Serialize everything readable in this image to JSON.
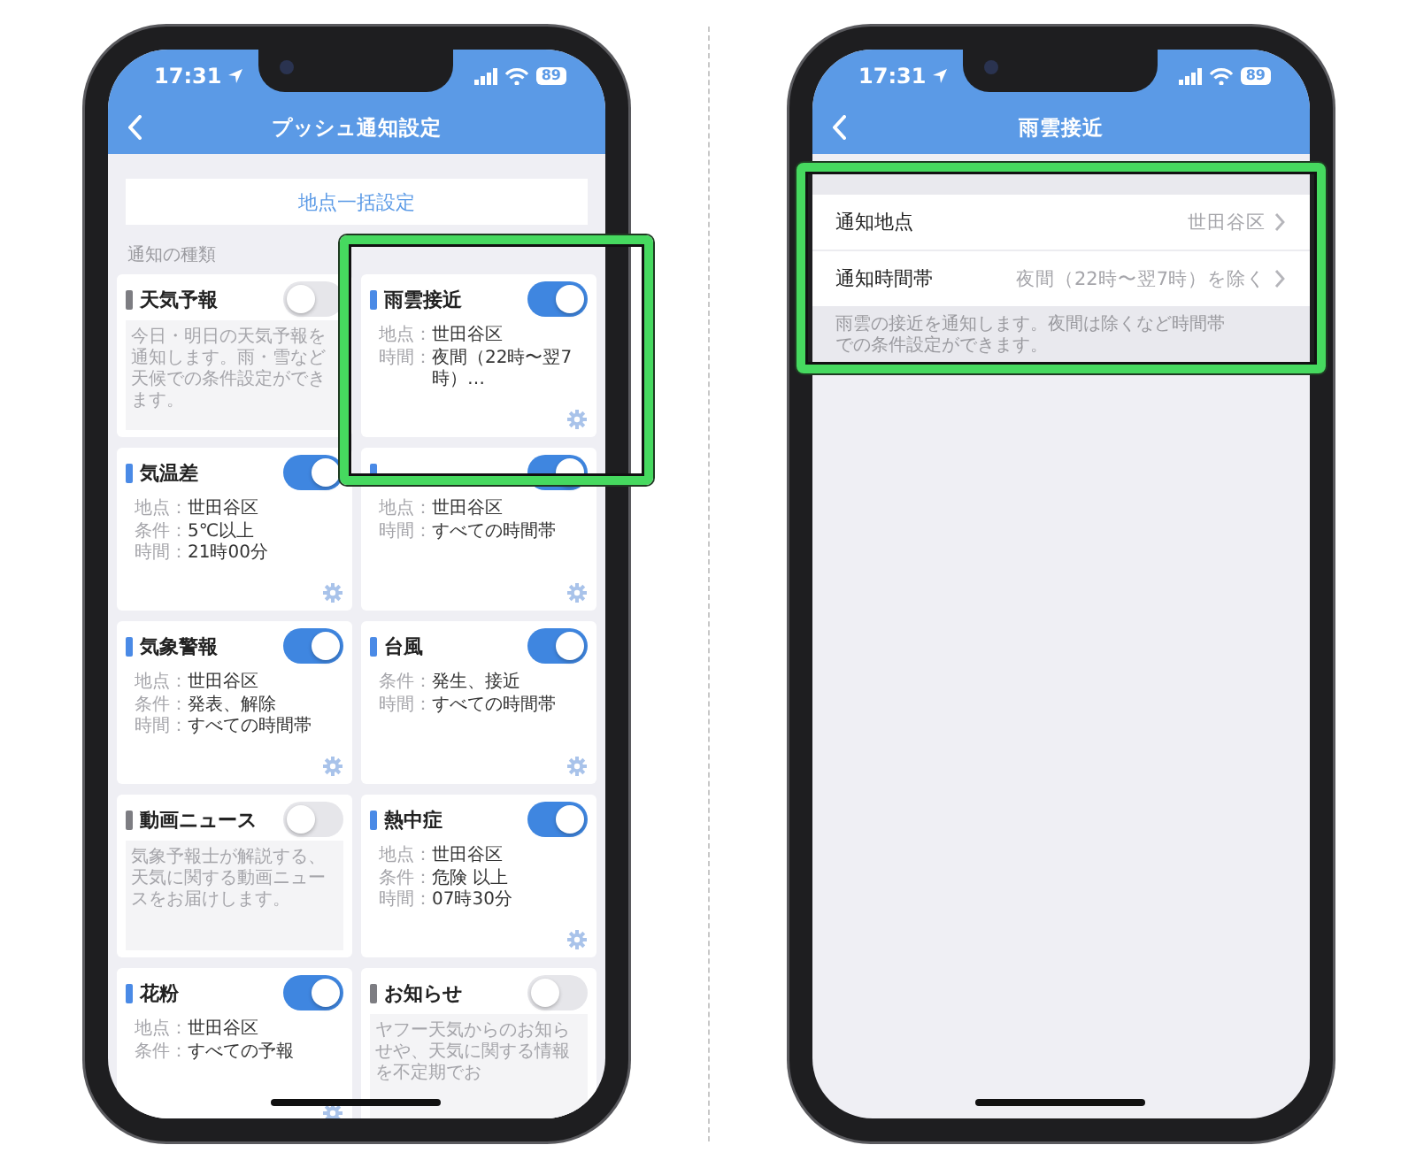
{
  "phones": [
    {
      "kind": "grid",
      "status": {
        "time": "17:31",
        "battery": "89"
      },
      "nav": {
        "title": "プッシュ通知設定"
      },
      "bulk_button": "地点一括設定",
      "section_label": "通知の種類",
      "cards": [
        {
          "title": "天気予報",
          "on": false,
          "description": "今日・明日の天気予報を通知します。雨・雪など天候での条件設定ができます。"
        },
        {
          "title": "雨雲接近",
          "on": true,
          "highlight": true,
          "details": [
            {
              "label": "地点：",
              "value": "世田谷区"
            },
            {
              "label": "時間：",
              "value": "夜間（22時〜翌7時）…"
            }
          ]
        },
        {
          "title": "気温差",
          "on": true,
          "details": [
            {
              "label": "地点：",
              "value": "世田谷区"
            },
            {
              "label": "条件：",
              "value": "5℃以上"
            },
            {
              "label": "時間：",
              "value": "21時00分"
            }
          ]
        },
        {
          "on": true,
          "details": [
            {
              "label": "地点：",
              "value": "世田谷区"
            },
            {
              "label": "時間：",
              "value": "すべての時間帯"
            }
          ]
        },
        {
          "title": "気象警報",
          "on": true,
          "details": [
            {
              "label": "地点：",
              "value": "世田谷区"
            },
            {
              "label": "条件：",
              "value": "発表、解除"
            },
            {
              "label": "時間：",
              "value": "すべての時間帯"
            }
          ]
        },
        {
          "title": "台風",
          "on": true,
          "details": [
            {
              "label": "条件：",
              "value": "発生、接近"
            },
            {
              "label": "時間：",
              "value": "すべての時間帯"
            }
          ]
        },
        {
          "title": "動画ニュース",
          "on": false,
          "description": "気象予報士が解説する、天気に関する動画ニュースをお届けします。"
        },
        {
          "title": "熱中症",
          "on": true,
          "details": [
            {
              "label": "地点：",
              "value": "世田谷区"
            },
            {
              "label": "条件：",
              "value": "危険 以上"
            },
            {
              "label": "時間：",
              "value": "07時30分"
            }
          ]
        },
        {
          "title": "花粉",
          "on": true,
          "details": [
            {
              "label": "地点：",
              "value": "世田谷区"
            },
            {
              "label": "条件：",
              "value": "すべての予報"
            }
          ]
        },
        {
          "title": "お知らせ",
          "on": false,
          "description": "ヤフー天気からのお知らせや、天気に関する情報を不定期でお"
        }
      ]
    },
    {
      "kind": "detail",
      "status": {
        "time": "17:31",
        "battery": "89"
      },
      "nav": {
        "title": "雨雲接近"
      },
      "highlight": true,
      "rows": [
        {
          "label": "通知地点",
          "value": "世田谷区"
        },
        {
          "label": "通知時間帯",
          "value": "夜間（22時〜翌7時）を除く"
        }
      ],
      "footnote": "雨雲の接近を通知します。夜間は除くなど時間帯での条件設定ができます。"
    }
  ]
}
